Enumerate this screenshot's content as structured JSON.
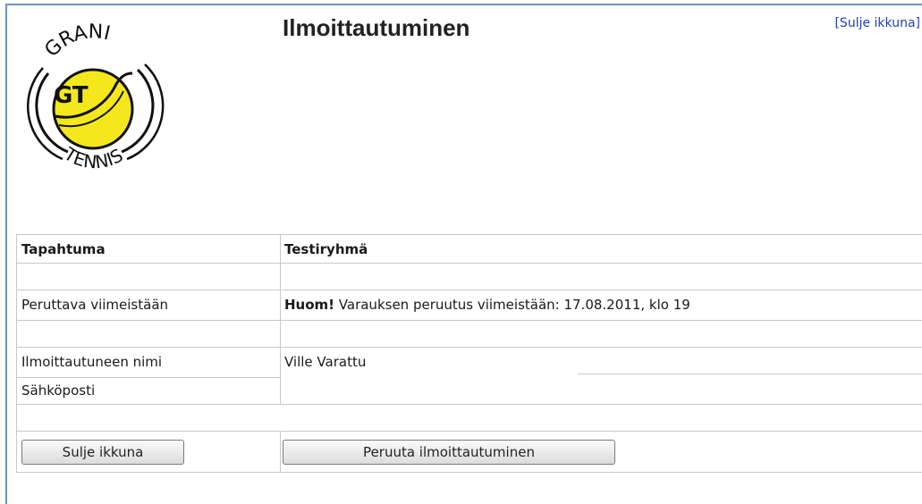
{
  "header": {
    "title": "Ilmoittautuminen",
    "close_link": "[Sulje ikkuna]"
  },
  "logo": {
    "text_top": "GRANI",
    "text_center": "GT",
    "text_bottom": "TENNIS",
    "ball_color": "#f4e81c"
  },
  "form": {
    "event_label": "Tapahtuma",
    "event_value": "Testiryhmä",
    "cancel_deadline_label": "Peruttava viimeistään",
    "notice_bold": "Huom!",
    "notice_text": " Varauksen peruutus viimeistään: 17.08.2011, klo 19",
    "name_label": "Ilmoittautuneen nimi",
    "name_value": "Ville Varattu",
    "email_label": "Sähköposti",
    "email_value": ""
  },
  "buttons": {
    "close": "Sulje ikkuna",
    "cancel_registration": "Peruuta ilmoittautuminen"
  },
  "colors": {
    "frame_border": "#6d93c0",
    "link": "#1f3fbf",
    "grid_line": "#c8c8c8"
  }
}
